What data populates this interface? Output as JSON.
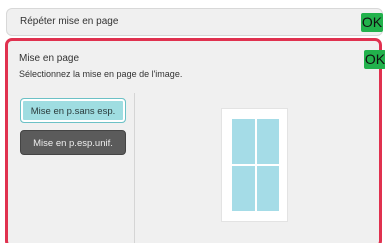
{
  "top_bar": {
    "title": "Répéter mise en page",
    "ok_label": "OK"
  },
  "panel": {
    "title": "Mise en page",
    "description": "Sélectionnez la mise en page de l'image.",
    "ok_label": "OK",
    "options": [
      {
        "label": "Mise en p.sans esp.",
        "selected": true
      },
      {
        "label": "Mise en p.esp.unif.",
        "selected": false
      }
    ]
  },
  "colors": {
    "ok_button": "#22b24c",
    "panel_border": "#e0314f",
    "selected_option": "#9fdde1",
    "unselected_option": "#5b5b5b",
    "preview_cell": "#a5dce7"
  }
}
